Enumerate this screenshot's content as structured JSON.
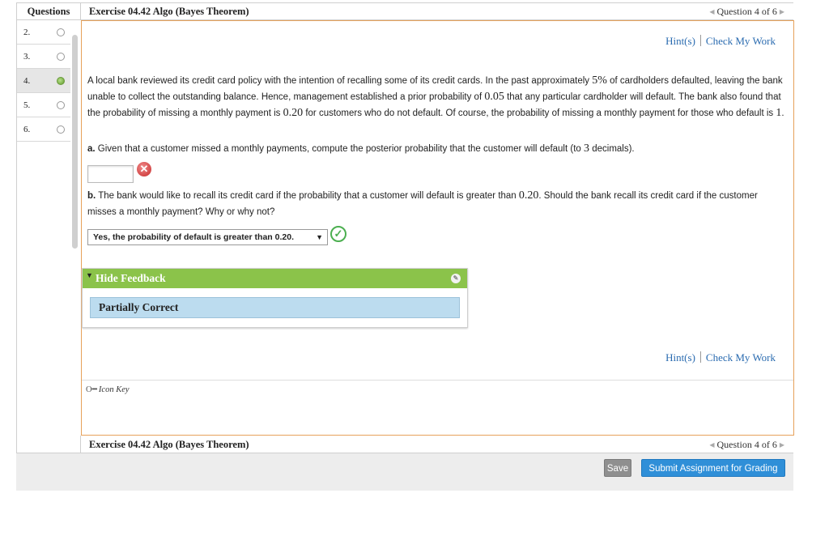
{
  "header": {
    "questions_label": "Questions",
    "title": "Exercise 04.42 Algo (Bayes Theorem)",
    "question_nav": "Question 4 of 6"
  },
  "question_list": [
    {
      "num": "2.",
      "status": "unanswered"
    },
    {
      "num": "3.",
      "status": "unanswered"
    },
    {
      "num": "4.",
      "status": "current"
    },
    {
      "num": "5.",
      "status": "unanswered"
    },
    {
      "num": "6.",
      "status": "unanswered"
    }
  ],
  "links": {
    "hint": "Hint(s)",
    "check": "Check My Work"
  },
  "problem": {
    "p1": "A local bank reviewed its credit card policy with the intention of recalling some of its credit cards. In the past approximately",
    "v1": "5%",
    "p2": "of cardholders defaulted, leaving the bank unable to collect the outstanding balance. Hence, management established a prior probability of",
    "v2": "0.05",
    "p3": "that any particular cardholder will default. The bank also found that the probability of missing a monthly payment is",
    "v3": "0.20",
    "p4": "for customers who do not default. Of course, the probability of missing a monthly payment for those who default is",
    "v4": "1",
    "p5": "."
  },
  "part_a": {
    "label": "a.",
    "text1": "Given that a customer missed a monthly payments, compute the posterior probability that the customer will default (to",
    "decimals": "3",
    "text2": "decimals).",
    "input_value": "",
    "result_icon": "incorrect-icon"
  },
  "part_b": {
    "label": "b.",
    "text1": "The bank would like to recall its credit card if the probability that a customer will default is greater than",
    "threshold": "0.20",
    "text2": ". Should the bank recall its credit card if the customer misses a monthly payment? Why or why not?",
    "selected_option": "Yes, the probability of default is greater than 0.20.",
    "result_icon": "correct-icon"
  },
  "feedback": {
    "toggle_label": "Hide Feedback",
    "status": "Partially Correct"
  },
  "icon_key": {
    "label": "Icon Key"
  },
  "footer": {
    "title": "Exercise 04.42 Algo (Bayes Theorem)",
    "question_nav": "Question 4 of 6",
    "save_label": "Save",
    "submit_label": "Submit Assignment for Grading"
  },
  "colors": {
    "accent_orange": "#e6a15a",
    "link_blue": "#2a6bb0",
    "feedback_green": "#8bc34a",
    "feedback_blue": "#bcdcef",
    "submit_blue": "#2f8fd8"
  }
}
